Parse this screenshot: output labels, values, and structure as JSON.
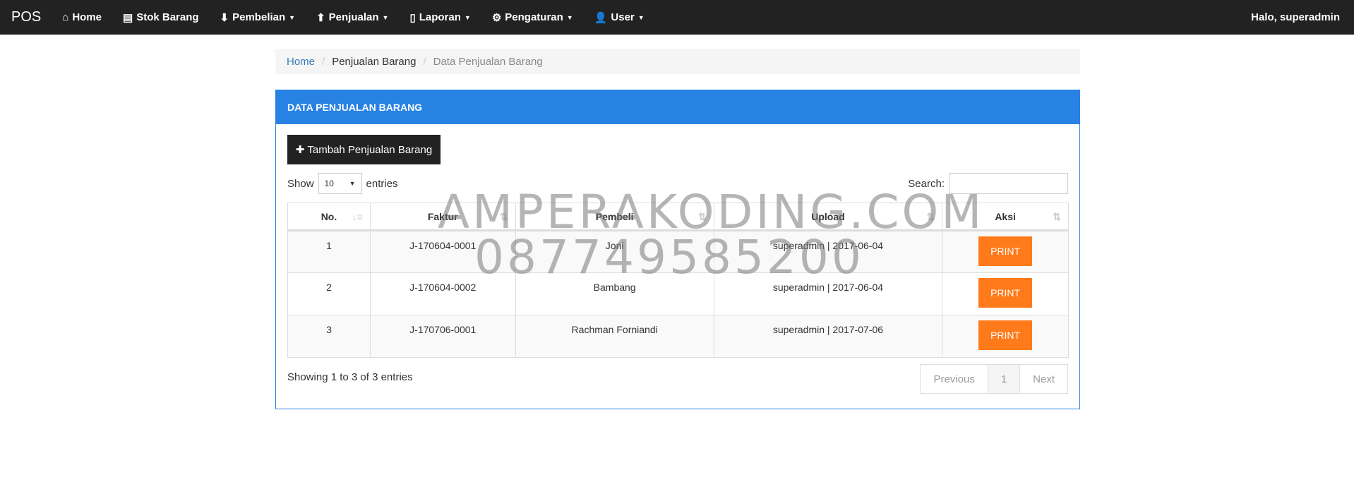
{
  "nav": {
    "brand": "POS",
    "items": [
      {
        "label": "Home",
        "icon": "home-icon",
        "glyph": "⌂",
        "caret": false
      },
      {
        "label": "Stok Barang",
        "icon": "archive-icon",
        "glyph": "▤",
        "caret": false
      },
      {
        "label": "Pembelian",
        "icon": "arrow-circle-down-icon",
        "glyph": "⬇",
        "caret": true
      },
      {
        "label": "Penjualan",
        "icon": "arrow-circle-up-icon",
        "glyph": "⬆",
        "caret": true
      },
      {
        "label": "Laporan",
        "icon": "file-icon",
        "glyph": "▯",
        "caret": true
      },
      {
        "label": "Pengaturan",
        "icon": "gear-icon",
        "glyph": "⚙",
        "caret": true
      },
      {
        "label": "User",
        "icon": "user-icon",
        "glyph": "👤",
        "caret": true
      }
    ],
    "greeting": "Halo, superadmin"
  },
  "breadcrumb": [
    "Home",
    "Penjualan Barang",
    "Data Penjualan Barang"
  ],
  "panel": {
    "title": "DATA PENJUALAN BARANG",
    "add_button": "Tambah Penjualan Barang",
    "show_label": "Show",
    "entries_value": "10",
    "entries_label": "entries",
    "search_label": "Search:",
    "search_value": "",
    "columns": [
      "No.",
      "Faktur",
      "Pembeli",
      "Upload",
      "Aksi"
    ],
    "rows": [
      {
        "no": "1",
        "faktur": "J-170604-0001",
        "pembeli": "Joni",
        "upload": "superadmin | 2017-06-04",
        "aksi": "PRINT"
      },
      {
        "no": "2",
        "faktur": "J-170604-0002",
        "pembeli": "Bambang",
        "upload": "superadmin | 2017-06-04",
        "aksi": "PRINT"
      },
      {
        "no": "3",
        "faktur": "J-170706-0001",
        "pembeli": "Rachman Forniandi",
        "upload": "superadmin | 2017-07-06",
        "aksi": "PRINT"
      }
    ],
    "info": "Showing 1 to 3 of 3 entries",
    "pagination": {
      "previous": "Previous",
      "current": "1",
      "next": "Next"
    }
  },
  "watermark": [
    "AMPERAKODING.COM",
    "087749585200"
  ],
  "colors": {
    "navbar": "#222222",
    "panel_header": "#2882e3",
    "print_button": "#ff7a1a"
  }
}
